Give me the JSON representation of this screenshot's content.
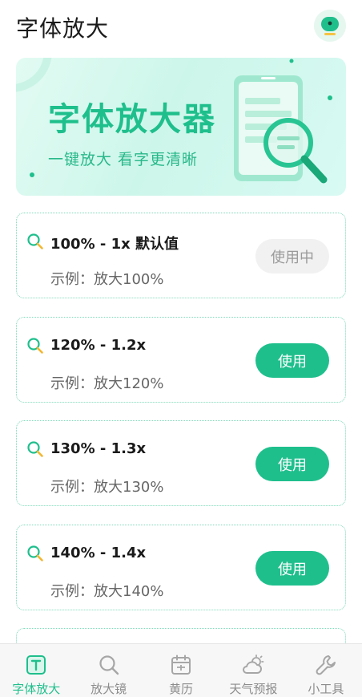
{
  "header": {
    "title": "字体放大",
    "avatar_icon": "robot-face-icon"
  },
  "banner": {
    "title": "字体放大器",
    "subtitle": "一键放大  看字更清晰"
  },
  "options": [
    {
      "title": "100% - 1x 默认值",
      "example": "示例：放大100%",
      "button": "使用中",
      "state": "in-use"
    },
    {
      "title": "120% - 1.2x",
      "example": "示例：放大120%",
      "button": "使用",
      "state": "available"
    },
    {
      "title": "130% - 1.3x",
      "example": "示例：放大130%",
      "button": "使用",
      "state": "available"
    },
    {
      "title": "140% - 1.4x",
      "example": "示例：放大140%",
      "button": "使用",
      "state": "available"
    }
  ],
  "tabbar": {
    "items": [
      {
        "label": "字体放大",
        "icon": "font-size-icon",
        "active": true
      },
      {
        "label": "放大镜",
        "icon": "magnifier-icon",
        "active": false
      },
      {
        "label": "黄历",
        "icon": "calendar-icon",
        "active": false
      },
      {
        "label": "天气预报",
        "icon": "weather-icon",
        "active": false
      },
      {
        "label": "小工具",
        "icon": "wrench-icon",
        "active": false
      }
    ]
  },
  "colors": {
    "accent": "#1fbf8c",
    "card_border": "#7ed9b9",
    "inactive": "#8c8c8c"
  }
}
